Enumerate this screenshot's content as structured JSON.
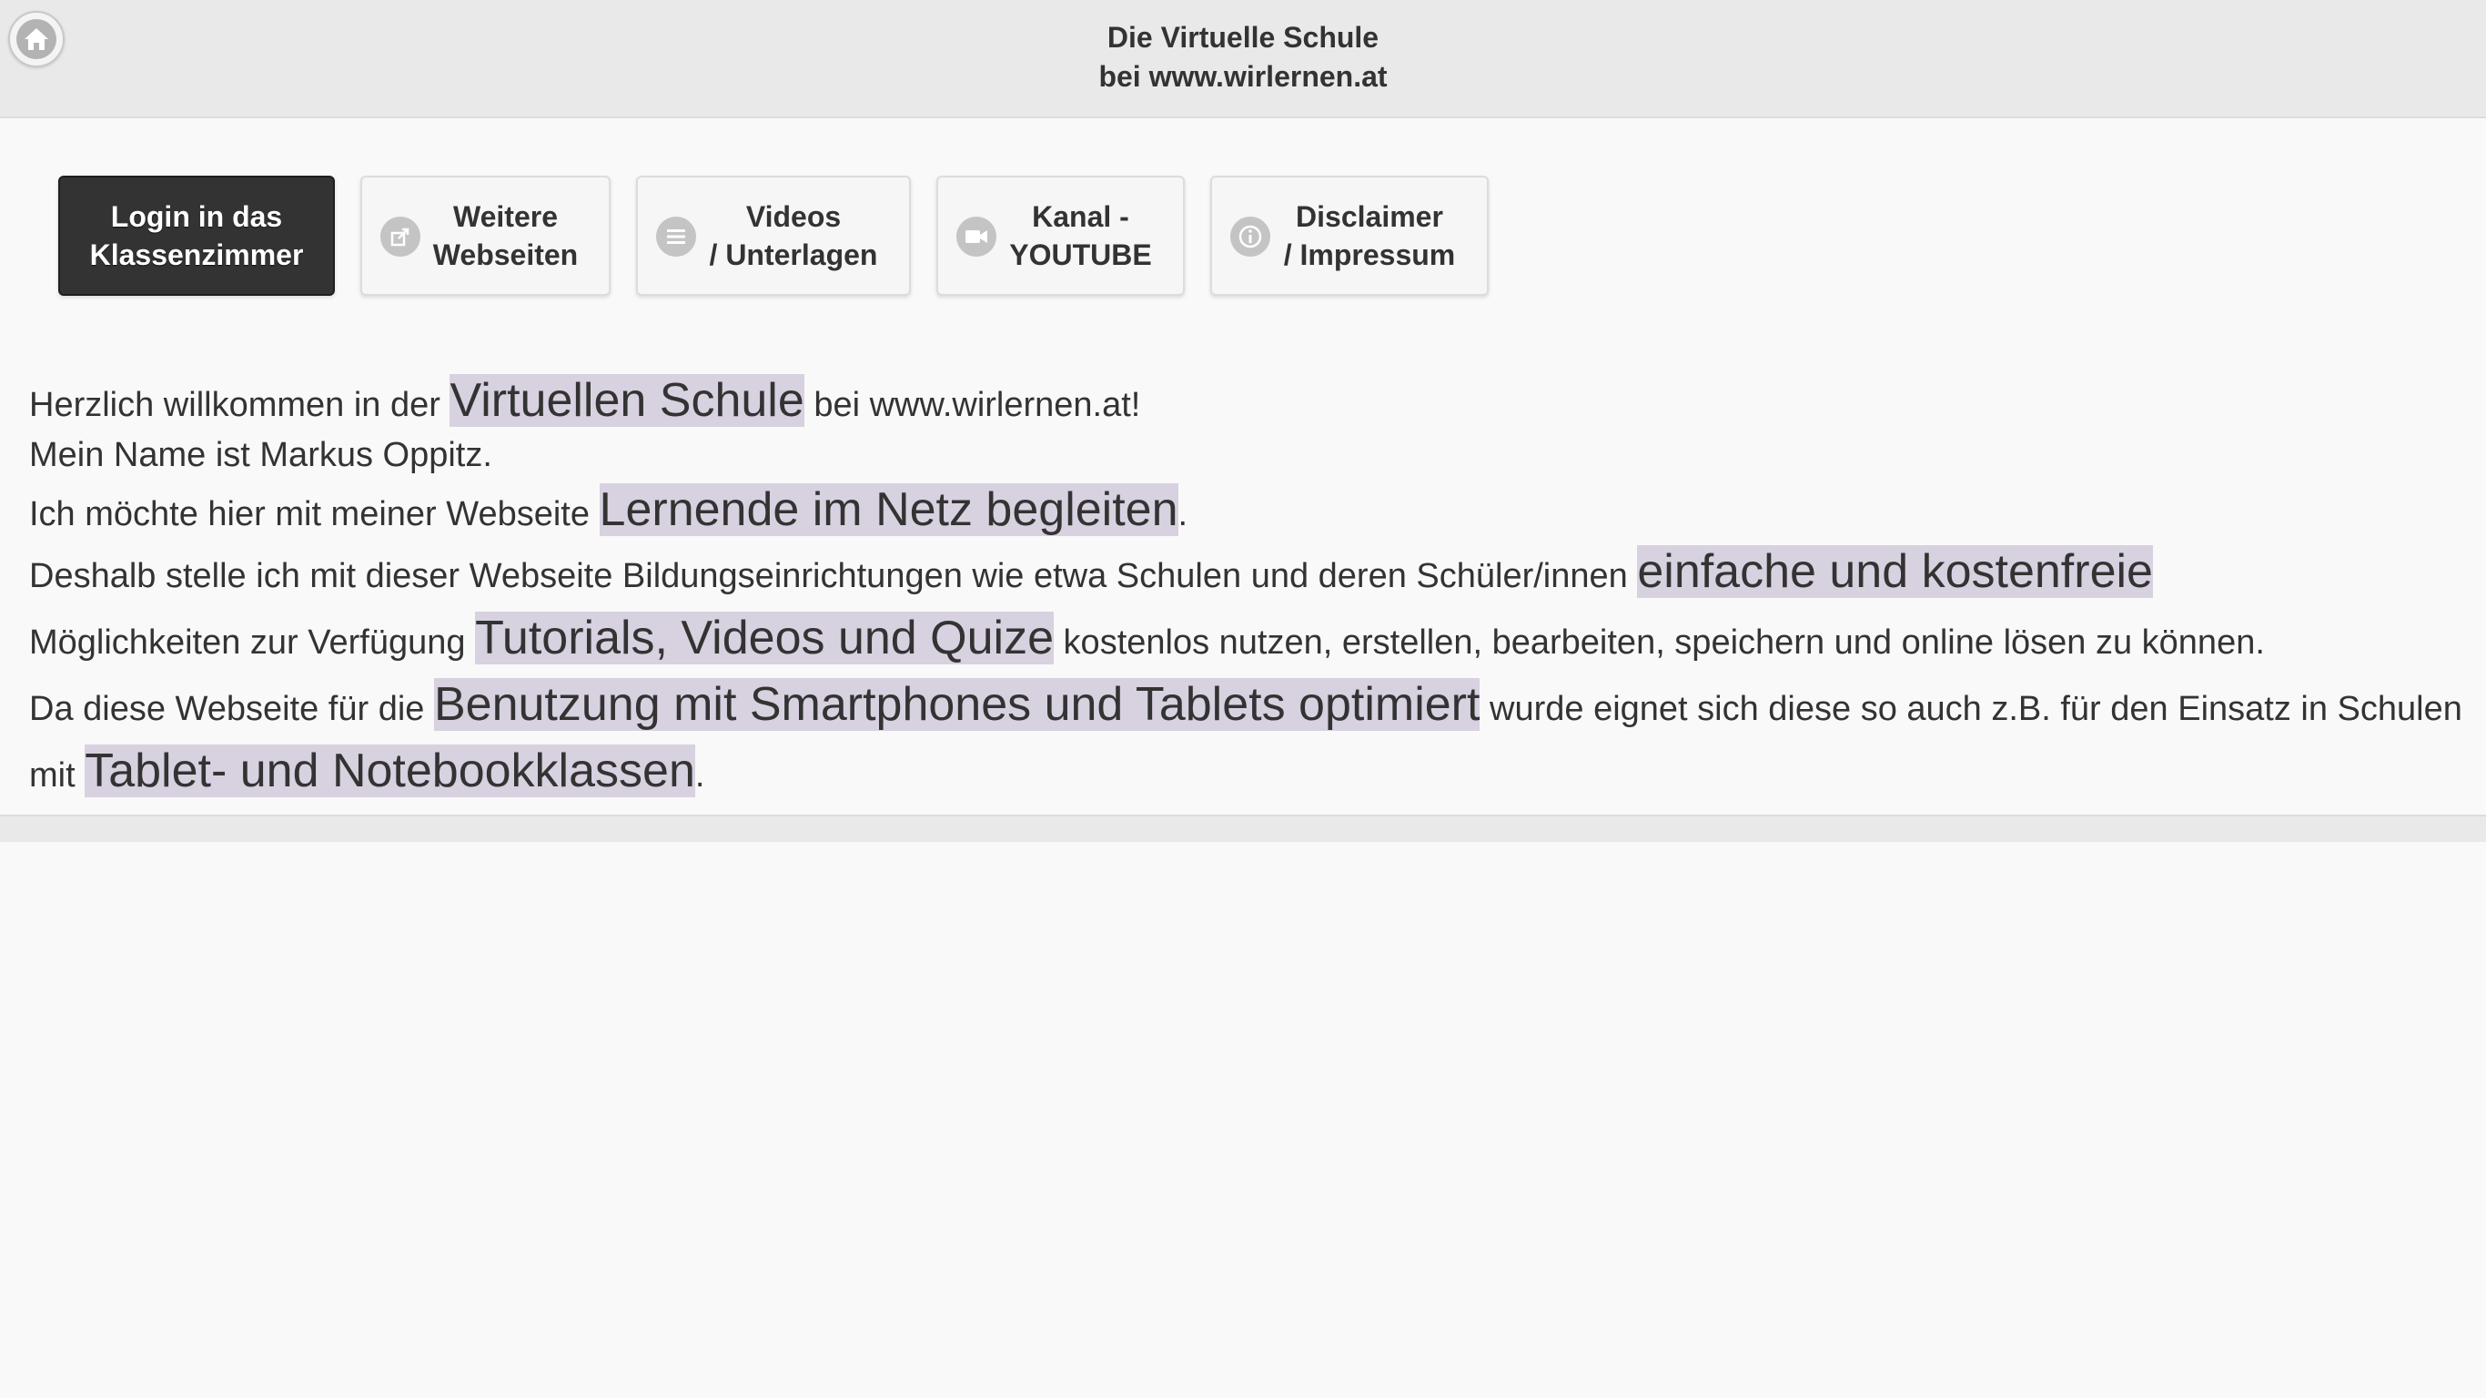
{
  "header": {
    "title_line1": "Die Virtuelle Schule",
    "title_line2": "bei www.wirlernen.at",
    "home_icon": "home-icon"
  },
  "nav": {
    "login": {
      "line1": "Login in das",
      "line2": "Klassenzimmer"
    },
    "weitere": {
      "line1": "Weitere",
      "line2": "Webseiten",
      "icon": "external-link-icon"
    },
    "videos": {
      "line1": "Videos",
      "line2": "/ Unterlagen",
      "icon": "list-icon"
    },
    "kanal": {
      "line1": "Kanal -",
      "line2": "YOUTUBE",
      "icon": "video-camera-icon"
    },
    "disclaimer": {
      "line1": "Disclaimer",
      "line2": "/ Impressum",
      "icon": "info-icon"
    }
  },
  "content": {
    "p1_a": "Herzlich willkommen in der ",
    "p1_hl": "Virtuellen Schule",
    "p1_b": " bei www.wirlernen.at!",
    "p2": "Mein Name ist Markus Oppitz.",
    "p3_a": "Ich möchte hier mit meiner Webseite ",
    "p3_hl": "Lernende im Netz begleiten",
    "p3_b": ".",
    "p4_a": "Deshalb stelle ich mit dieser Webseite Bildungseinrichtungen wie etwa Schulen und deren Schüler/innen ",
    "p4_hl1": "einfache und kostenfreie",
    "p4_b": " Möglichkeiten zur Verfügung ",
    "p4_hl2": "Tutorials, Videos und Quize",
    "p4_c": " kostenlos nutzen, erstellen, bearbeiten, speichern und online lösen zu können.",
    "p5_a": "Da diese Webseite für die ",
    "p5_hl1": "Benutzung mit Smartphones und Tablets optimiert",
    "p5_b": " wurde eignet sich diese so auch z.B. für den Einsatz in Schulen mit ",
    "p5_hl2": "Tablet- und Notebookklassen",
    "p5_c": "."
  },
  "colors": {
    "header_bg": "#e9e9e9",
    "page_bg": "#f9f9f9",
    "active_button": "#333333",
    "highlight": "#d8d1e0"
  }
}
